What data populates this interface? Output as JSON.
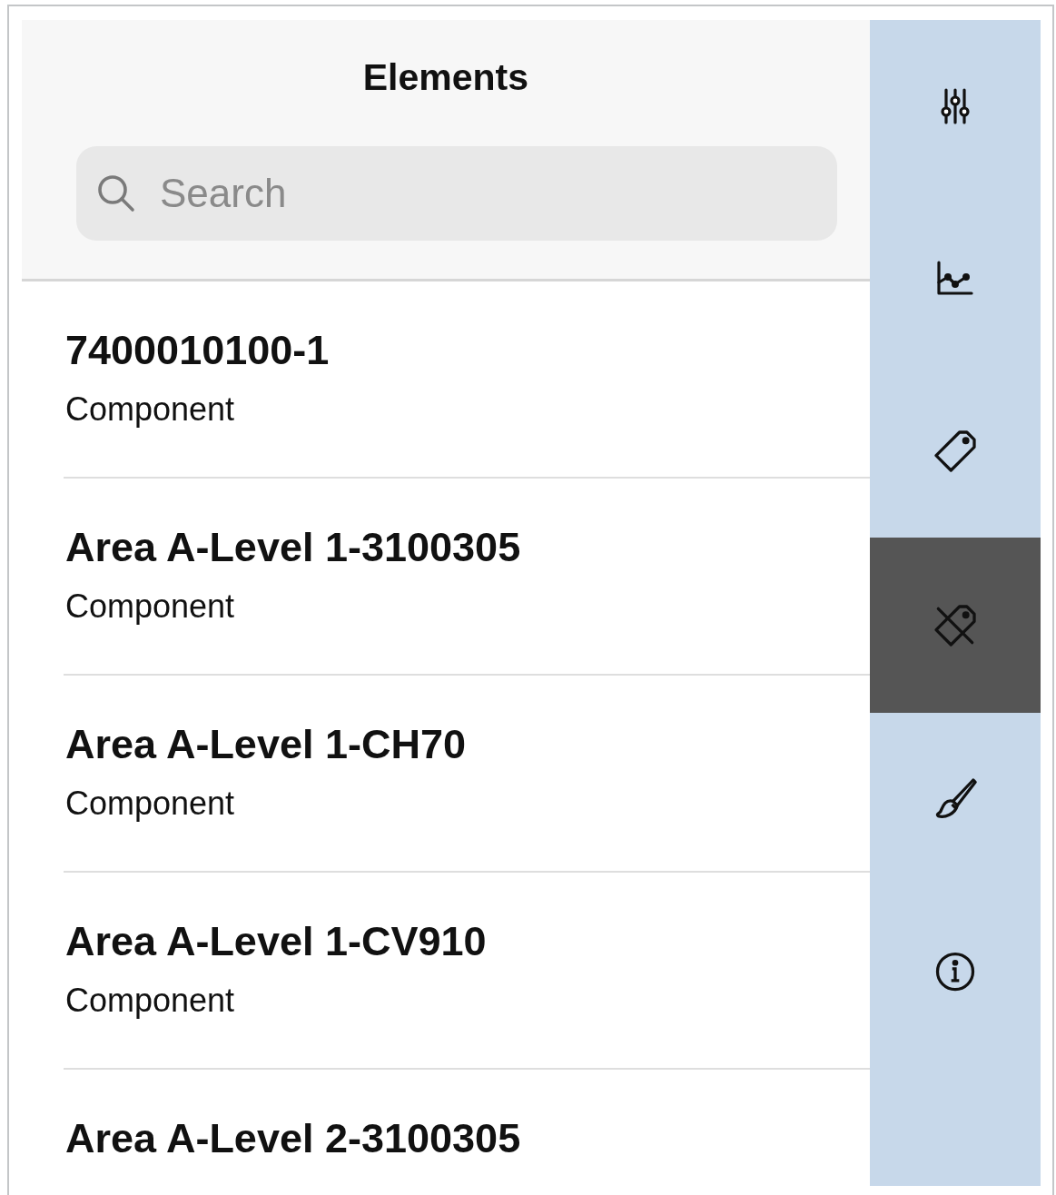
{
  "header": {
    "title": "Elements"
  },
  "search": {
    "placeholder": "Search"
  },
  "elements": [
    {
      "name": "7400010100-1",
      "type": "Component"
    },
    {
      "name": "Area A-Level 1-3100305",
      "type": "Component"
    },
    {
      "name": "Area A-Level 1-CH70",
      "type": "Component"
    },
    {
      "name": "Area A-Level 1-CV910",
      "type": "Component"
    },
    {
      "name": "Area A-Level 2-3100305"
    }
  ],
  "sidebar": {
    "tabs": [
      {
        "kind": "sliders",
        "selected": false
      },
      {
        "kind": "chart",
        "selected": false
      },
      {
        "kind": "tag",
        "selected": false
      },
      {
        "kind": "untag",
        "selected": true
      },
      {
        "kind": "brush",
        "selected": false
      },
      {
        "kind": "info",
        "selected": false
      }
    ]
  }
}
